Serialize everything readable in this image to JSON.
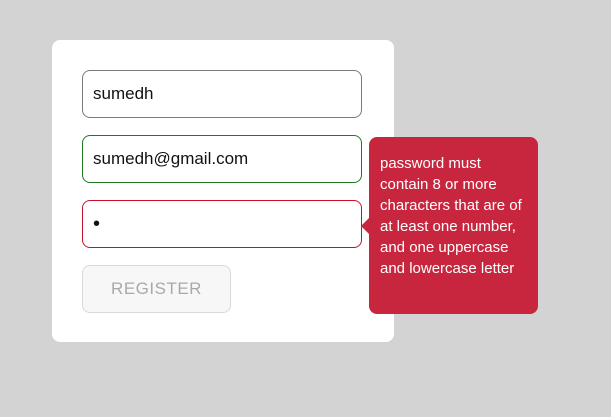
{
  "form": {
    "username_value": "sumedh",
    "email_value": "sumedh@gmail.com",
    "password_value": "•",
    "register_label": "REGISTER"
  },
  "tooltip": {
    "message": "password must contain 8 or more characters that are of at least one number, and one uppercase and lowercase letter"
  },
  "colors": {
    "background": "#d3d3d3",
    "card": "#ffffff",
    "valid_border": "#1f7a1f",
    "invalid_border": "#c8102e",
    "tooltip_bg": "#c8263e"
  }
}
